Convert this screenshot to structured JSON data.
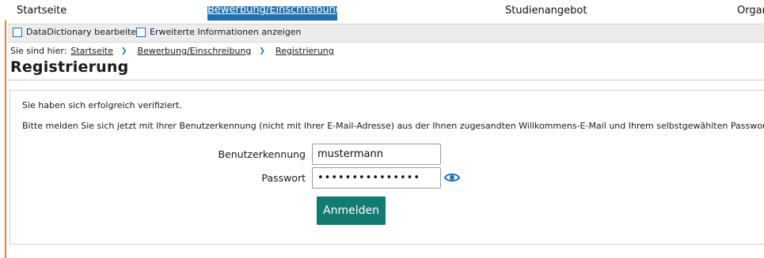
{
  "topnav": {
    "items": [
      {
        "label": "Startseite"
      },
      {
        "label": "Bewerbung/Einschreibung",
        "active": true
      },
      {
        "label": "Studienangebot"
      },
      {
        "label": "Organ"
      }
    ]
  },
  "options": {
    "datadictionary_label": "DataDictionary bearbeiten",
    "extended_info_label": "Erweiterte Informationen anzeigen"
  },
  "breadcrumb": {
    "prefix": "Sie sind hier:",
    "items": [
      "Startseite",
      "Bewerbung/Einschreibung",
      "Registrierung"
    ],
    "separator": "❯"
  },
  "page": {
    "title": "Registrierung"
  },
  "content": {
    "message_verified": "Sie haben sich erfolgreich verifiziert.",
    "message_instructions": "Bitte melden Sie sich jetzt mit Ihrer Benutzerkennung (nicht mit Ihrer E-Mail-Adresse) aus der Ihnen zugesandten Willkommens-E-Mail und Ihrem selbstgewählten Passwort an."
  },
  "form": {
    "username_label": "Benutzerkennung",
    "username_value": "mustermann",
    "password_label": "Passwort",
    "password_value": "•••••••••••••••",
    "show_password_icon": "eye-icon",
    "submit_label": "Anmelden"
  },
  "colors": {
    "accent_blue": "#1f6fb2",
    "button_teal": "#137b72",
    "left_accent": "#d98a2b"
  }
}
